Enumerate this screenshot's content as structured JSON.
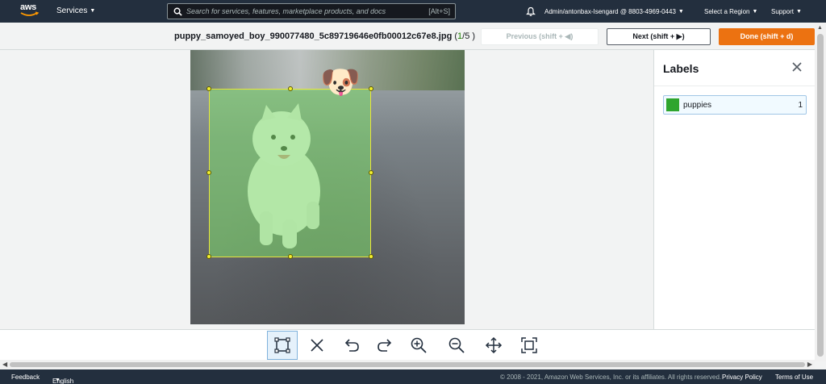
{
  "topnav": {
    "logo_text": "aws",
    "services_label": "Services",
    "search_placeholder": "Search for services, features, marketplace products, and docs",
    "search_shortcut": "[Alt+S]",
    "account": "Admin/antonbax-Isengard @ 8803-4969-0443",
    "region": "Select a Region",
    "support": "Support"
  },
  "header": {
    "filename": "puppy_samoyed_boy_990077480_5c89719646e0fb00012c67e8.jpg",
    "index_open": "(",
    "index_current": "1",
    "index_total": "/5 )",
    "prev_label": "Previous (shift + ◀)",
    "next_label": "Next (shift + ▶)",
    "done_label": "Done (shift + d)"
  },
  "annotation": {
    "emoji": "🐶",
    "box_color": "#7ddc69"
  },
  "labels_panel": {
    "title": "Labels",
    "items": [
      {
        "name": "puppies",
        "count": "1",
        "color": "#2ea52e"
      }
    ]
  },
  "toolbar": {
    "tools": [
      "bounding-box-tool",
      "delete-tool",
      "undo-tool",
      "redo-tool",
      "zoom-in-tool",
      "zoom-out-tool",
      "move-tool",
      "fit-screen-tool"
    ]
  },
  "footer": {
    "feedback": "Feedback",
    "language": "English (US)",
    "copyright": "© 2008 - 2021, Amazon Web Services, Inc. or its affiliates. All rights reserved.",
    "privacy": "Privacy Policy",
    "terms": "Terms of Use"
  }
}
